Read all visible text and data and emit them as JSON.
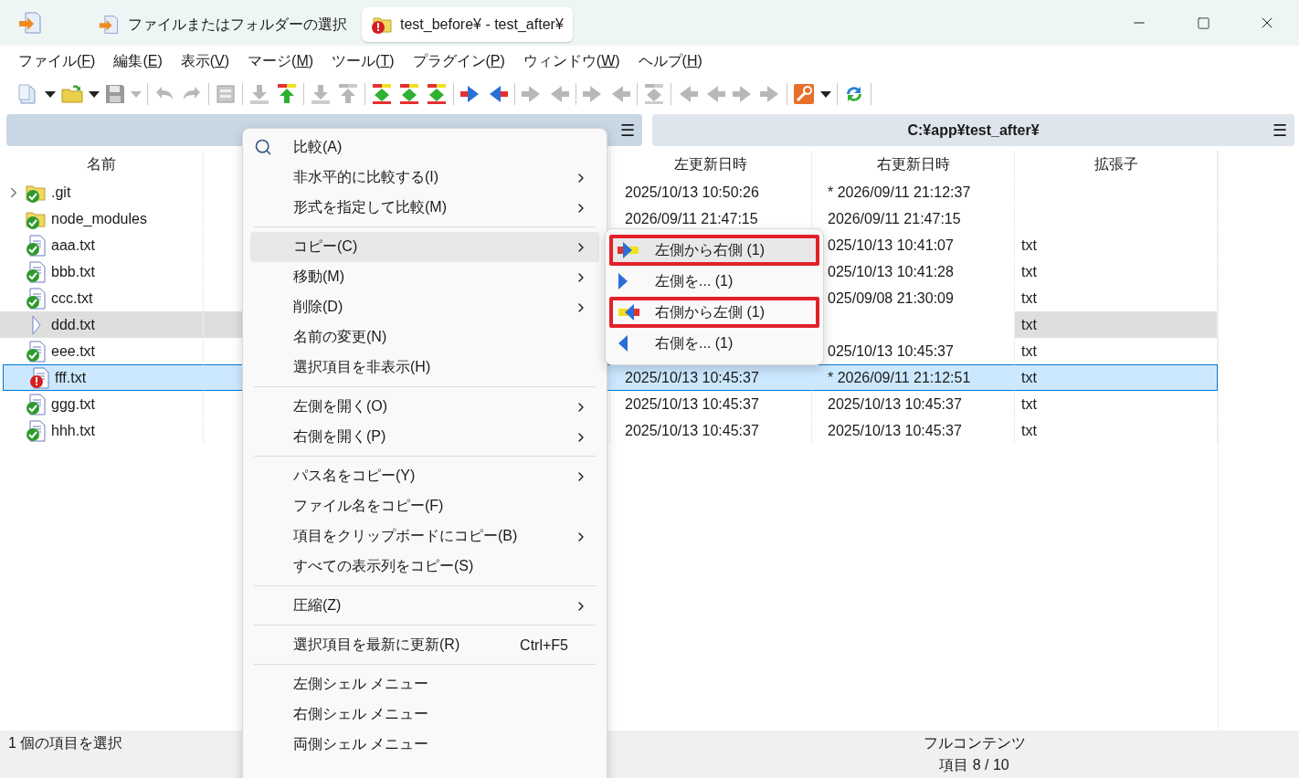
{
  "window": {
    "tabs": [
      {
        "label": "ファイルまたはフォルダーの選択",
        "selected": false
      },
      {
        "label": "test_before¥ - test_after¥",
        "selected": true
      }
    ]
  },
  "menubar": [
    "ファイル(F)",
    "編集(E)",
    "表示(V)",
    "マージ(M)",
    "ツール(T)",
    "プラグイン(P)",
    "ウィンドウ(W)",
    "ヘルプ(H)"
  ],
  "toolbar": [
    {
      "kind": "new",
      "disabled": false
    },
    {
      "kind": "caret",
      "disabled": false
    },
    {
      "kind": "open",
      "disabled": false
    },
    {
      "kind": "caret",
      "disabled": false
    },
    {
      "kind": "save",
      "disabled": true
    },
    {
      "kind": "caret",
      "disabled": true
    },
    {
      "kind": "separator"
    },
    {
      "kind": "undo",
      "disabled": true
    },
    {
      "kind": "redo",
      "disabled": true
    },
    {
      "kind": "separator"
    },
    {
      "kind": "report",
      "disabled": true
    },
    {
      "kind": "separator"
    },
    {
      "kind": "down",
      "disabled": true
    },
    {
      "kind": "up",
      "disabled": false
    },
    {
      "kind": "separator"
    },
    {
      "kind": "down",
      "disabled": true
    },
    {
      "kind": "up",
      "disabled": true
    },
    {
      "kind": "separator"
    },
    {
      "kind": "diff",
      "disabled": false
    },
    {
      "kind": "diff",
      "disabled": false
    },
    {
      "kind": "diff",
      "disabled": false
    },
    {
      "kind": "separator"
    },
    {
      "kind": "right",
      "disabled": false
    },
    {
      "kind": "left",
      "disabled": false
    },
    {
      "kind": "separator"
    },
    {
      "kind": "right",
      "disabled": true
    },
    {
      "kind": "left",
      "disabled": true
    },
    {
      "kind": "separator"
    },
    {
      "kind": "right",
      "disabled": true
    },
    {
      "kind": "left",
      "disabled": true
    },
    {
      "kind": "separator"
    },
    {
      "kind": "diff",
      "disabled": true
    },
    {
      "kind": "separator"
    },
    {
      "kind": "left",
      "disabled": true
    },
    {
      "kind": "left",
      "disabled": true
    },
    {
      "kind": "right",
      "disabled": true
    },
    {
      "kind": "right",
      "disabled": true
    },
    {
      "kind": "separator"
    },
    {
      "kind": "tools",
      "disabled": false
    },
    {
      "kind": "caret",
      "disabled": false
    },
    {
      "kind": "separator"
    },
    {
      "kind": "refresh",
      "disabled": false
    },
    {
      "kind": "separator"
    }
  ],
  "paths": [
    {
      "menu": "☰",
      "selected": true
    },
    {
      "text": "C:¥app¥test_after¥",
      "menu": "☰",
      "selected": false
    }
  ],
  "table": {
    "columns": [
      "名前",
      "左更新日時",
      "右更新日時",
      "拡張子"
    ],
    "rows": [
      {
        "name": ".git",
        "kind": "same-folder",
        "expandable": true,
        "selected": false,
        "left_date": "2025/10/13 10:50:26",
        "right_date": "* 2026/09/11 21:12:37"
      },
      {
        "name": "node_modules",
        "kind": "same-folder",
        "expandable": false,
        "selected": false,
        "left_date": "2026/09/11 21:47:15",
        "right_date": "2026/09/11 21:47:15"
      },
      {
        "name": "aaa.txt",
        "kind": "same-file",
        "expandable": false,
        "selected": false,
        "right_date": "025/10/13 10:41:07",
        "ext": "txt"
      },
      {
        "name": "bbb.txt",
        "kind": "same-file",
        "expandable": false,
        "selected": false,
        "right_date": "025/10/13 10:41:28",
        "ext": "txt"
      },
      {
        "name": "ccc.txt",
        "kind": "same-file",
        "expandable": false,
        "selected": false,
        "right_date": "025/09/08 21:30:09",
        "ext": "txt"
      },
      {
        "name": "ddd.txt",
        "kind": "left-only-file",
        "expandable": false,
        "selected": false,
        "ext": "txt"
      },
      {
        "name": "eee.txt",
        "kind": "same-file",
        "expandable": false,
        "selected": false,
        "right_date": "025/10/13 10:45:37",
        "ext": "txt"
      },
      {
        "name": "fff.txt",
        "kind": "different-file",
        "expandable": false,
        "selected": true,
        "left_date": "2025/10/13 10:45:37",
        "right_date": "* 2026/09/11 21:12:51",
        "ext": "txt"
      },
      {
        "name": "ggg.txt",
        "kind": "same-file",
        "expandable": false,
        "selected": false,
        "left_date": "2025/10/13 10:45:37",
        "right_date": "2025/10/13 10:45:37",
        "ext": "txt"
      },
      {
        "name": "hhh.txt",
        "kind": "same-file",
        "expandable": false,
        "selected": false,
        "left_date": "2025/10/13 10:45:37",
        "right_date": "2025/10/13 10:45:37",
        "ext": "txt"
      }
    ]
  },
  "context_menu": [
    {
      "kind": "item",
      "label": "比較(A)",
      "submenu": false,
      "selected": false
    },
    {
      "kind": "item",
      "label": "非水平的に比較する(I)",
      "submenu": true,
      "selected": false
    },
    {
      "kind": "item",
      "label": "形式を指定して比較(M)",
      "submenu": true,
      "selected": false
    },
    {
      "kind": "separator"
    },
    {
      "kind": "item",
      "label": "コピー(C)",
      "submenu": true,
      "selected": true
    },
    {
      "kind": "item",
      "label": "移動(M)",
      "submenu": true,
      "selected": false
    },
    {
      "kind": "item",
      "label": "削除(D)",
      "submenu": true,
      "selected": false
    },
    {
      "kind": "item",
      "label": "名前の変更(N)",
      "submenu": false,
      "selected": false
    },
    {
      "kind": "item",
      "label": "選択項目を非表示(H)",
      "submenu": false,
      "selected": false
    },
    {
      "kind": "separator"
    },
    {
      "kind": "item",
      "label": "左側を開く(O)",
      "submenu": true,
      "selected": false
    },
    {
      "kind": "item",
      "label": "右側を開く(P)",
      "submenu": true,
      "selected": false
    },
    {
      "kind": "separator"
    },
    {
      "kind": "item",
      "label": "パス名をコピー(Y)",
      "submenu": true,
      "selected": false
    },
    {
      "kind": "item",
      "label": "ファイル名をコピー(F)",
      "submenu": false,
      "selected": false
    },
    {
      "kind": "item",
      "label": "項目をクリップボードにコピー(B)",
      "submenu": true,
      "selected": false
    },
    {
      "kind": "item",
      "label": "すべての表示列をコピー(S)",
      "submenu": false,
      "selected": false
    },
    {
      "kind": "separator"
    },
    {
      "kind": "item",
      "label": "圧縮(Z)",
      "submenu": true,
      "selected": false
    },
    {
      "kind": "separator"
    },
    {
      "kind": "item",
      "label": "選択項目を最新に更新(R)",
      "shortcut": "Ctrl+F5",
      "submenu": false,
      "selected": false
    },
    {
      "kind": "separator"
    },
    {
      "kind": "item",
      "label": "左側シェル メニュー",
      "submenu": false,
      "selected": false
    },
    {
      "kind": "item",
      "label": "右側シェル メニュー",
      "submenu": false,
      "selected": false
    },
    {
      "kind": "item",
      "label": "両側シェル メニュー",
      "submenu": false,
      "selected": false
    }
  ],
  "submenu": [
    {
      "label": "左側から右側 (1)",
      "outlined": true,
      "selected": true
    },
    {
      "label": "左側を... (1)",
      "outlined": false,
      "selected": false
    },
    {
      "label": "右側から左側 (1)",
      "outlined": true,
      "selected": false
    },
    {
      "label": "右側を... (1)",
      "outlined": false,
      "selected": false
    }
  ],
  "status_bar": {
    "left": "1 個の項目を選択",
    "right": [
      "フルコンテンツ",
      "項目 8 / 10"
    ]
  }
}
